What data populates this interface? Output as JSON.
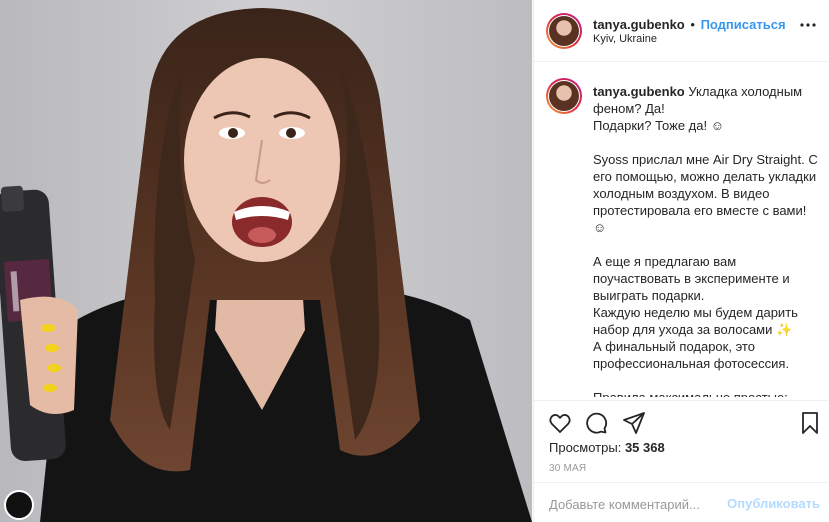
{
  "post": {
    "username": "tanya.gubenko",
    "dot": "•",
    "follow_label": "Подписаться",
    "location": "Kyiv, Ukraine"
  },
  "caption": {
    "username": "tanya.gubenko",
    "text": " Укладка холодным феном? Да!\nПодарки? Тоже да! ☺\n\nSyoss прислал мне Air Dry Straight. С его помощью, можно делать укладки холодным воздухом. В видео протестировала его вместе с вами! ☺\n\nА еще я предлагаю вам поучаствовать в эксперименте и выиграть подарки.\nКаждую неделю мы будем дарить набор для ухода за волосами ✨\nА финальный подарок, это профессиональная фотосессия.\n\nПравила максимально простые:\n•Выставляете фото или видео с вашими красивыми волосами"
  },
  "stats": {
    "views_label": "Просмотры:",
    "views_count": "35 368",
    "date": "30 МАЯ"
  },
  "comment": {
    "placeholder": "Добавьте комментарий...",
    "publish_label": "Опубликовать"
  },
  "icons": {
    "like": "heart-icon",
    "comment": "comment-icon",
    "share": "share-icon",
    "save": "bookmark-icon",
    "more": "more-icon"
  },
  "colors": {
    "link_blue": "#3897f0",
    "publish_disabled": "#b3dbff",
    "border": "#efefef"
  }
}
